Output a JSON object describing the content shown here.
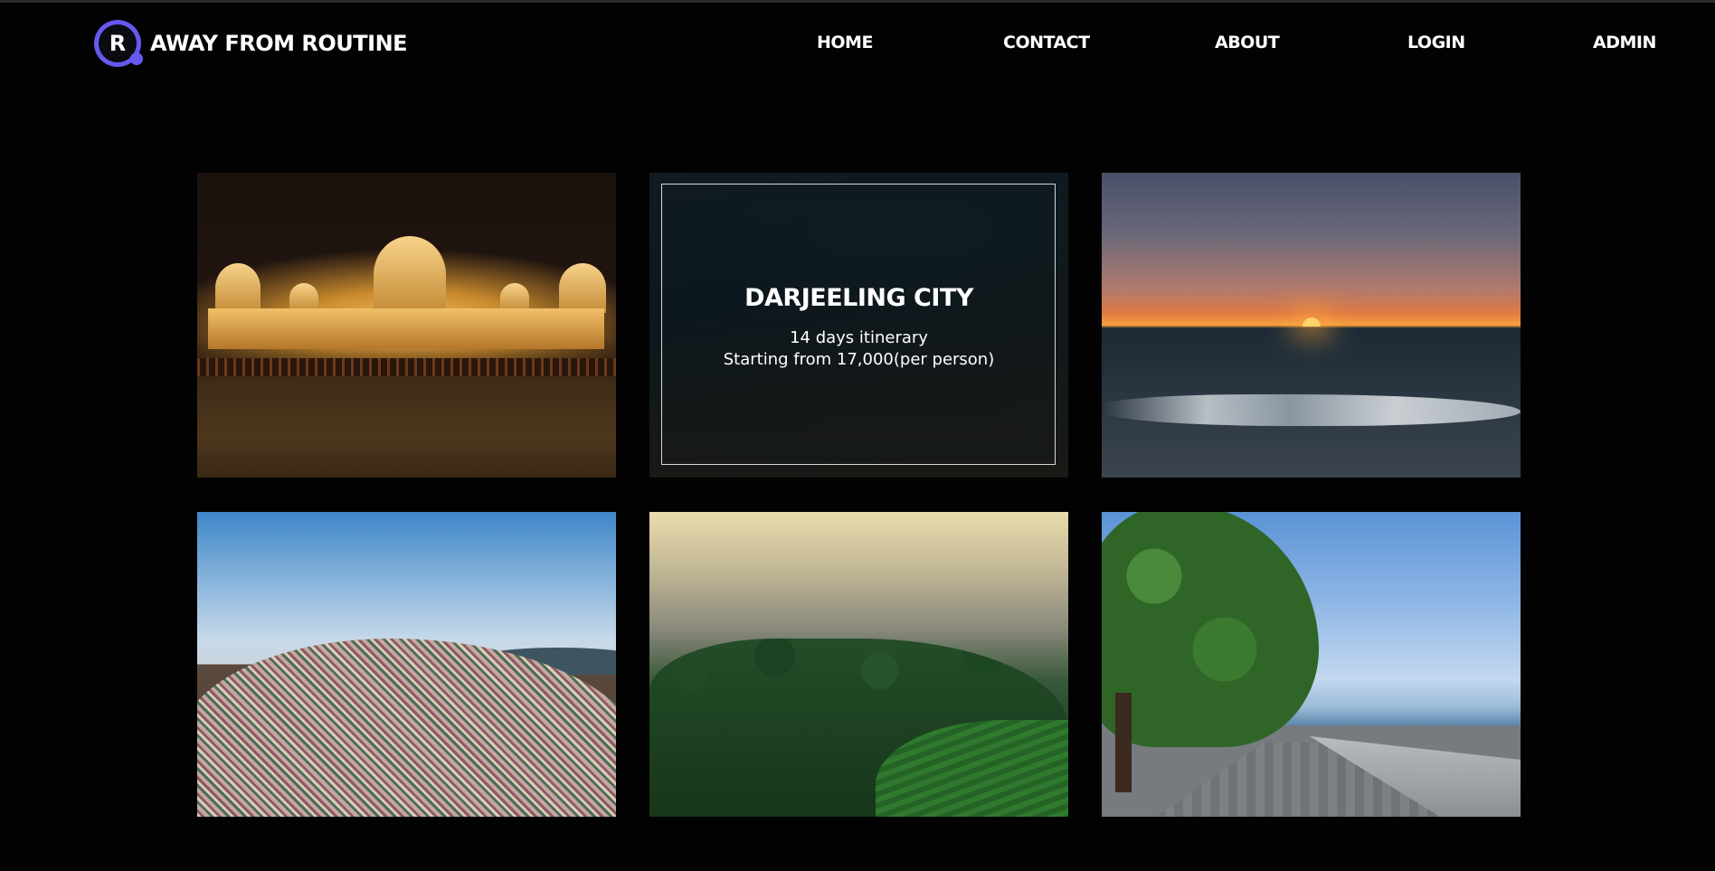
{
  "brand": {
    "name": "AWAY FROM ROUTINE",
    "logo_icon": "logo-r-icon",
    "accent_color": "#6559f0"
  },
  "nav": {
    "home": "HOME",
    "contact": "CONTACT",
    "about": "ABOUT",
    "login": "LOGIN",
    "admin": "ADMIN"
  },
  "tiles": [
    {
      "scene": "palace-at-night"
    },
    {
      "scene": "darjeeling-mountain-road",
      "title": "DARJEELING CITY",
      "line1": "14 days itinerary",
      "line2": "Starting from 17,000(per person)"
    },
    {
      "scene": "sunset-over-sea"
    },
    {
      "scene": "hillside-town"
    },
    {
      "scene": "misty-forest"
    },
    {
      "scene": "seaside-promenade"
    }
  ]
}
